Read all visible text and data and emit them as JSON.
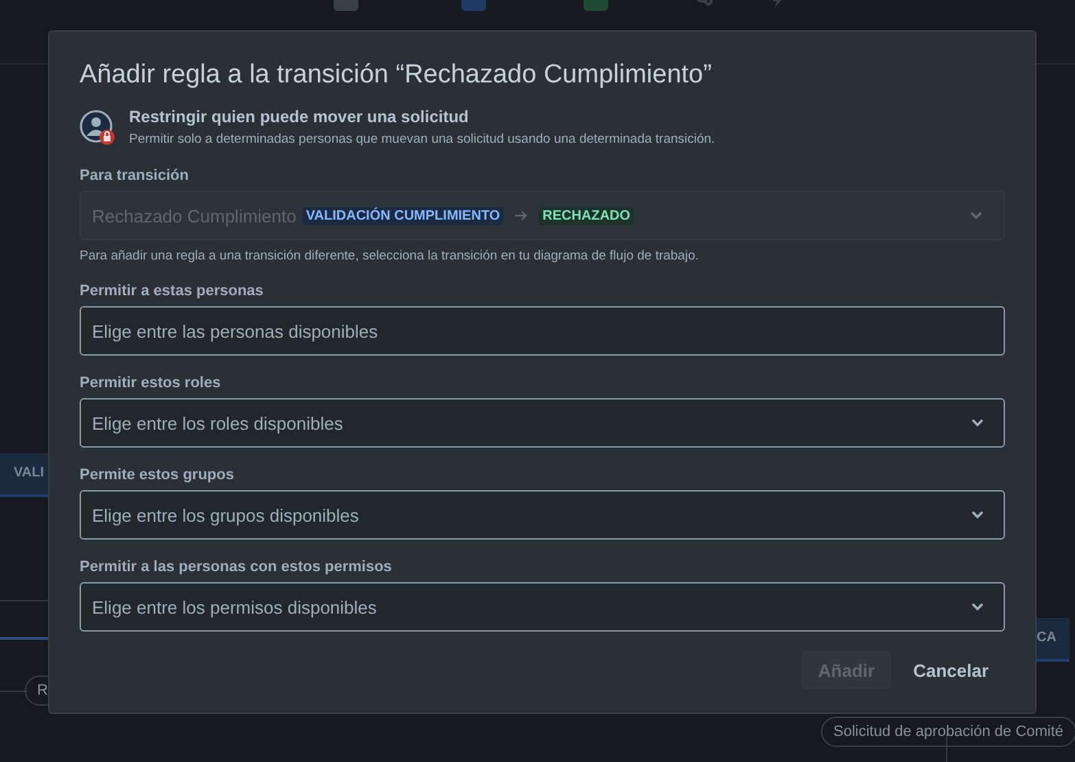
{
  "background": {
    "toolbar": [
      {
        "kind": "plus",
        "color": "#3b4048"
      },
      {
        "kind": "plus",
        "color": "#1f3a66"
      },
      {
        "kind": "plus",
        "color": "#1f4a30"
      },
      {
        "kind": "transition",
        "color": "#3b4048"
      },
      {
        "kind": "rule",
        "color": "#3b4048"
      }
    ],
    "nodes": [
      {
        "kind": "status",
        "text": "VALI"
      },
      {
        "kind": "status",
        "text": "CA"
      },
      {
        "kind": "pill",
        "text": "R"
      },
      {
        "kind": "pill",
        "text": "Solicitud de aprobación de Comité"
      }
    ]
  },
  "dialog": {
    "title": "Añadir regla a la transición “Rechazado Cumplimiento”",
    "info": {
      "heading": "Restringir quien puede mover una solicitud",
      "description": "Permitir solo a determinadas personas que muevan una solicitud usando una determinada transición."
    },
    "transition": {
      "label": "Para transición",
      "value": "Rechazado Cumplimiento",
      "from_status": "VALIDACIÓN CUMPLIMIENTO",
      "to_status": "RECHAZADO",
      "disabled": true,
      "help": "Para añadir una regla a una transición diferente, selecciona la transición en tu diagrama de flujo de trabajo."
    },
    "fields": [
      {
        "label": "Permitir a estas personas",
        "placeholder": "Elige entre las personas disponibles",
        "kind": "text"
      },
      {
        "label": "Permitir estos roles",
        "placeholder": "Elige entre los roles disponibles",
        "kind": "select"
      },
      {
        "label": "Permite estos grupos",
        "placeholder": "Elige entre los grupos disponibles",
        "kind": "select"
      },
      {
        "label": "Permitir a las personas con estos permisos",
        "placeholder": "Elige entre los permisos disponibles",
        "kind": "select"
      }
    ],
    "buttons": [
      {
        "label": "Añadir",
        "kind": "primary",
        "disabled": true
      },
      {
        "label": "Cancelar",
        "kind": "subtle",
        "disabled": false
      }
    ]
  }
}
